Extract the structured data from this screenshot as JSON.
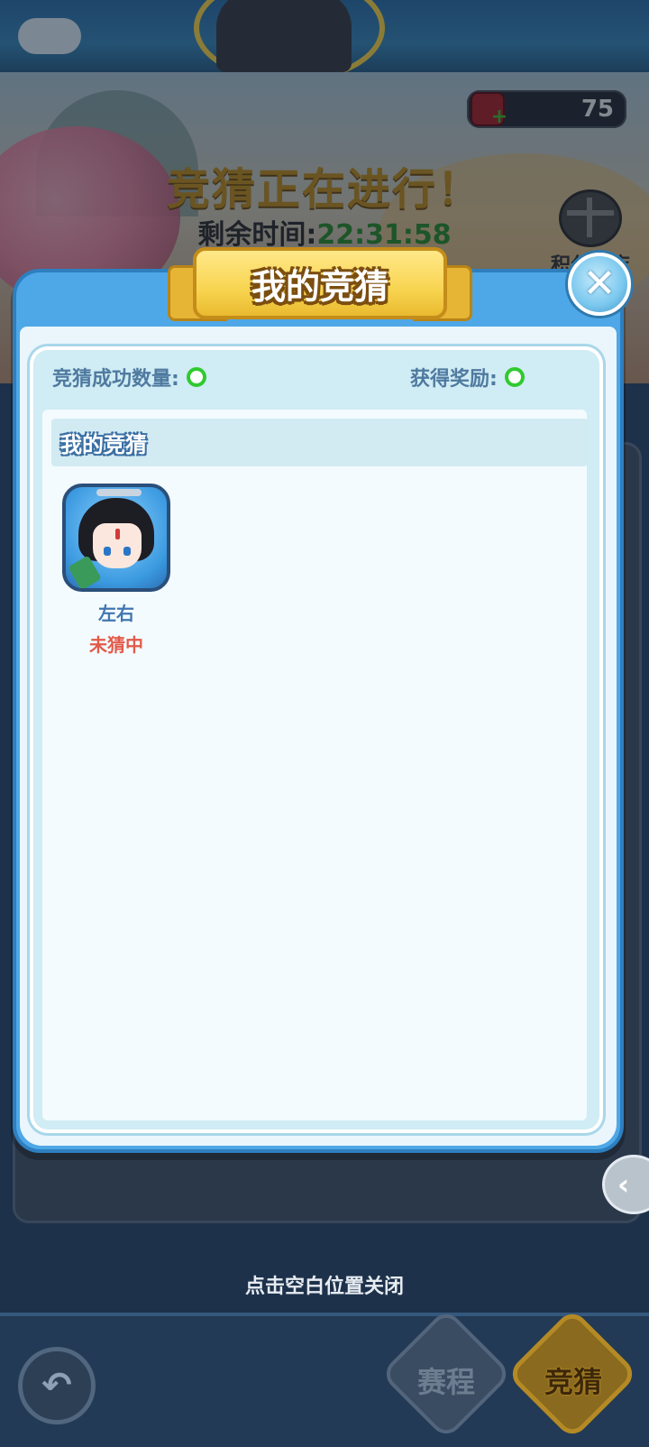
{
  "header": {
    "currency_count": "75",
    "event_title": "竞猜正在进行！",
    "timer_label": "剩余时间:",
    "timer_value": "22:31:58",
    "shop_label": "积分商店"
  },
  "modal": {
    "title": "我的竞猜",
    "close_symbol": "✕",
    "stats": {
      "success_label": "竞猜成功数量:",
      "reward_label": "获得奖励:"
    },
    "section_title": "我的竞猜",
    "entries": [
      {
        "name": "左右",
        "status": "未猜中"
      }
    ]
  },
  "hint": "点击空白位置关闭",
  "bottom_nav": {
    "back_icon": "back-arrow-icon",
    "tabs": [
      {
        "label": "赛程"
      },
      {
        "label": "竞猜"
      }
    ]
  },
  "colors": {
    "modal_blue": "#4ea7e6",
    "ribbon_gold": "#f8d450",
    "status_red": "#e35a4a",
    "indicator_green": "#2fca2f"
  }
}
